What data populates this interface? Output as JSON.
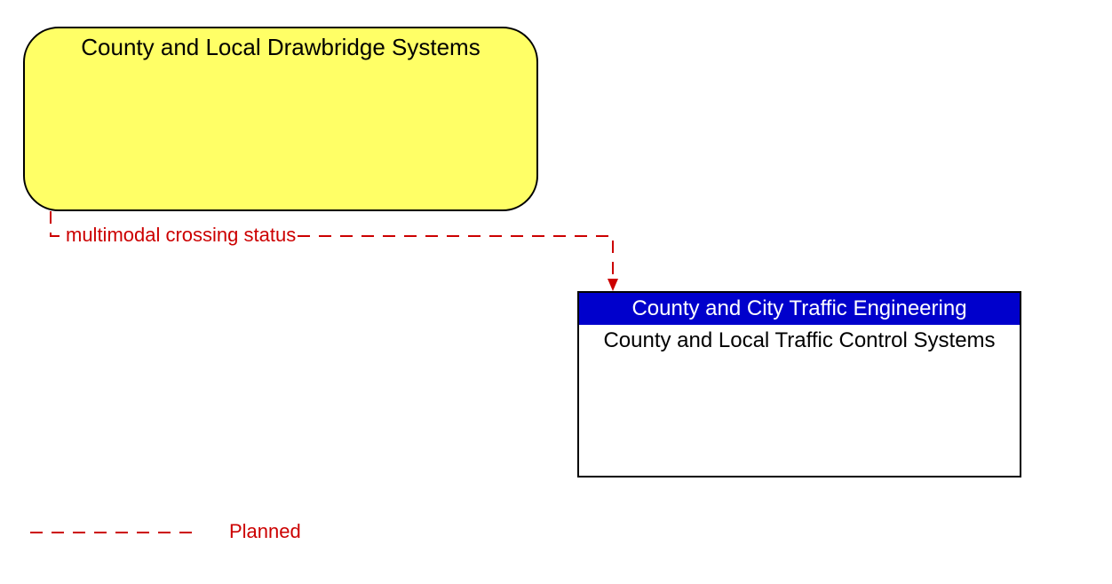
{
  "nodes": {
    "drawbridge": {
      "title": "County and Local Drawbridge Systems"
    },
    "traffic": {
      "header": "County and City Traffic Engineering",
      "body": "County and Local Traffic Control Systems"
    }
  },
  "flow": {
    "label": "multimodal crossing status"
  },
  "legend": {
    "planned": "Planned"
  }
}
